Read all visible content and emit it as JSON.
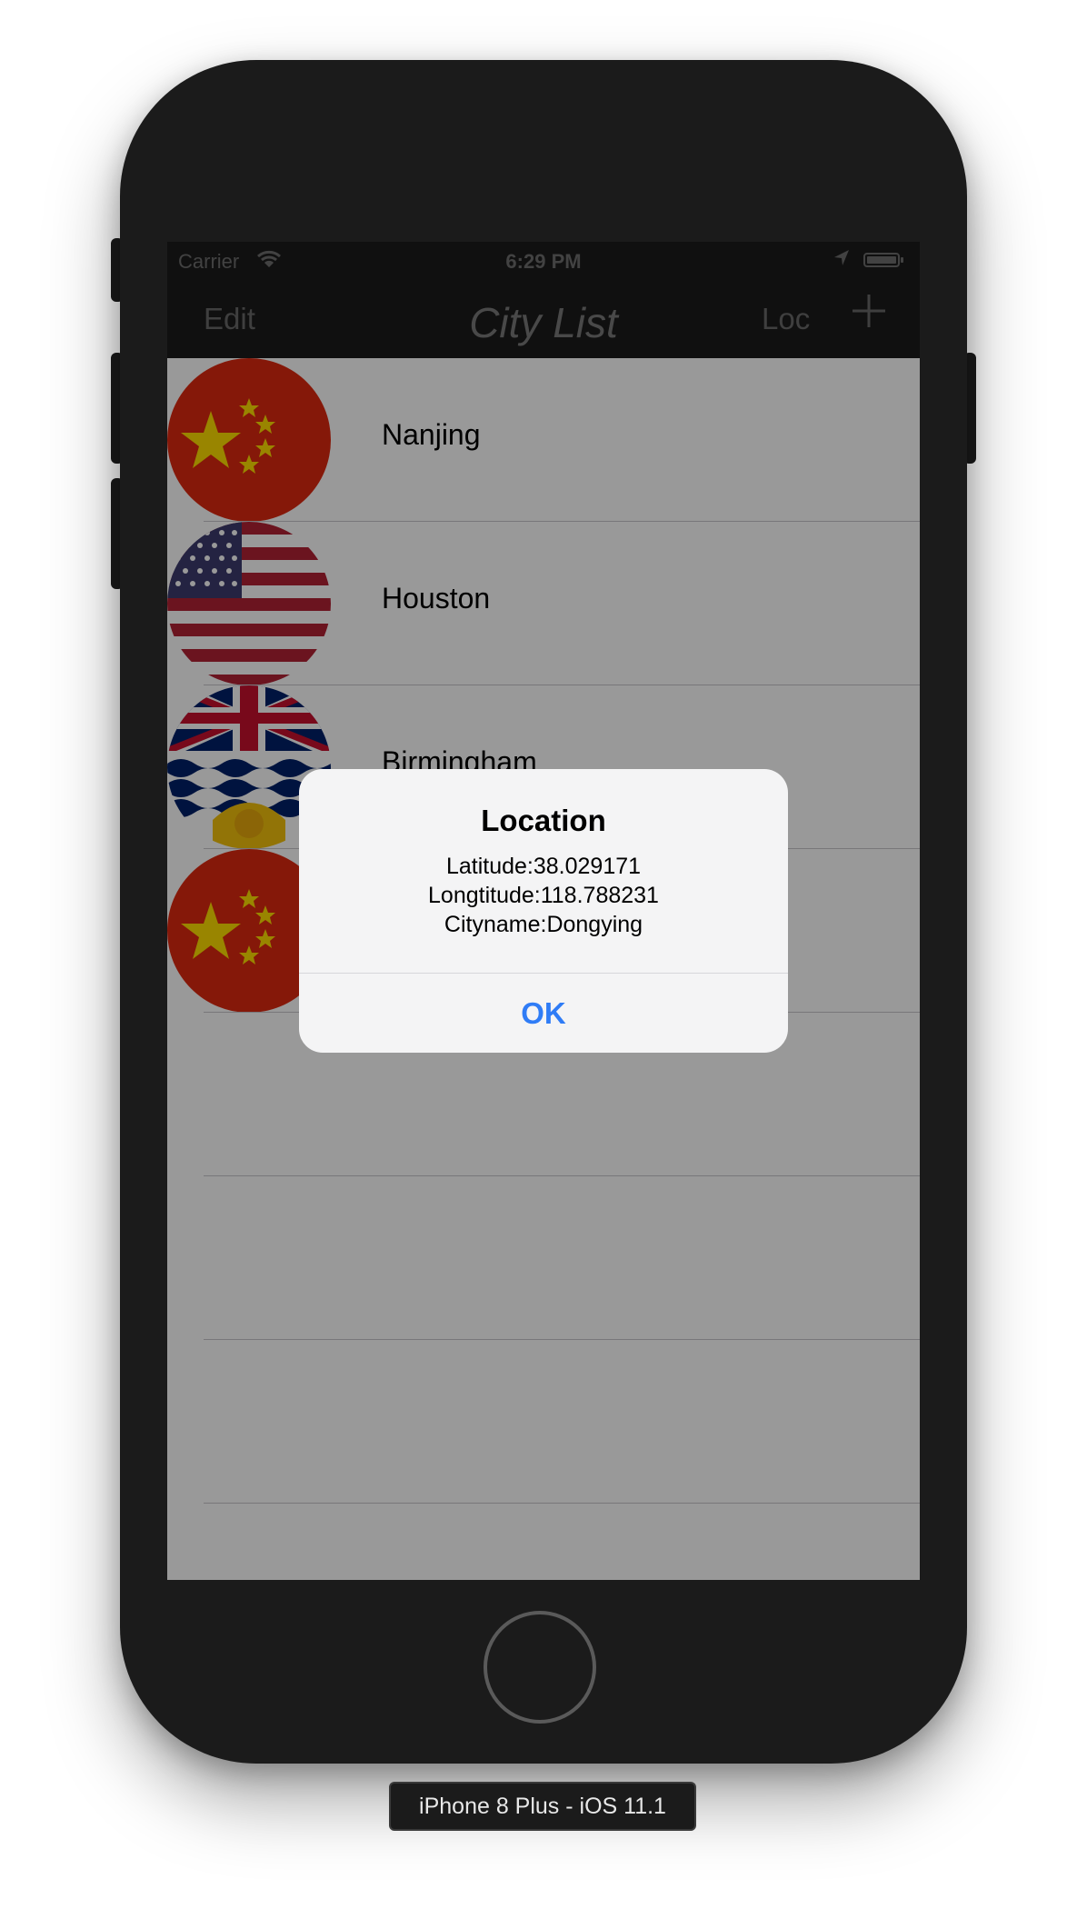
{
  "status_bar": {
    "carrier": "Carrier",
    "time": "6:29 PM"
  },
  "nav_bar": {
    "edit_label": "Edit",
    "title": "City List",
    "loc_label": "Loc",
    "add_icon": "plus-icon"
  },
  "cities": [
    {
      "name": "Nanjing",
      "flag": "china-flag-icon"
    },
    {
      "name": "Houston",
      "flag": "usa-flag-icon"
    },
    {
      "name": "Birmingham",
      "flag": "british-columbia-flag-icon"
    },
    {
      "name": "",
      "flag": "china-flag-icon"
    }
  ],
  "alert": {
    "title": "Location",
    "latitude": "Latitude:38.029171",
    "longitude": "Longtitude:118.788231",
    "cityname": "Cityname:Dongying",
    "ok_label": "OK"
  },
  "device_label": "iPhone 8 Plus - iOS 11.1",
  "colors": {
    "flag_red": "#de2910",
    "flag_gold": "#ffde00",
    "us_blue": "#3c3b6e",
    "us_red": "#b22234",
    "uk_blue": "#012169",
    "uk_red": "#c8102e",
    "alert_button": "#2f7cf6"
  }
}
